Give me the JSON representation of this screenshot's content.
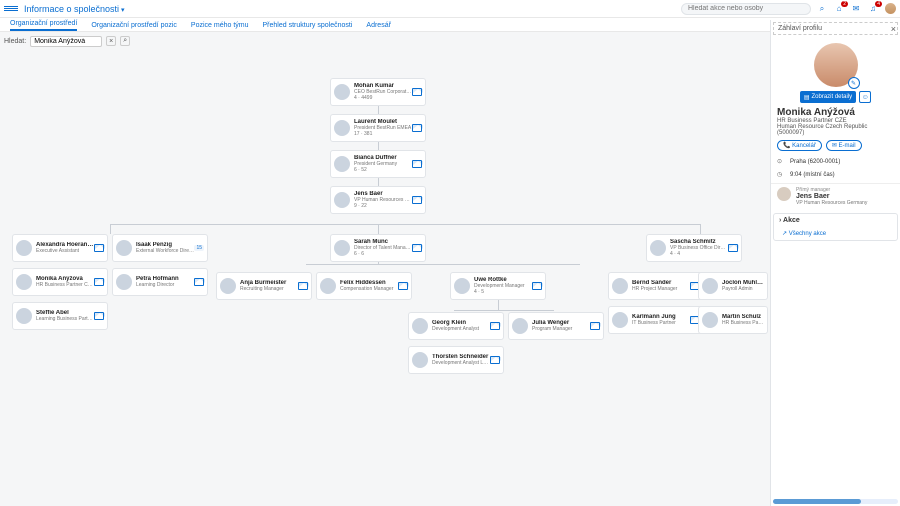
{
  "header": {
    "title": "Informace o společnosti",
    "search_placeholder": "Hledat akce nebo osoby",
    "notif1": "2",
    "notif2": "4"
  },
  "tabs": [
    "Organizační prostředí",
    "Organizační prostředí pozic",
    "Pozice mého týmu",
    "Přehled struktury společnosti",
    "Adresář"
  ],
  "find": {
    "label": "Hledat:",
    "value": "Monika Anýžová"
  },
  "org": {
    "c1": {
      "name": "Mohan Kumar",
      "role": "CEO BestRun Corporation",
      "sub": "4 · 4499"
    },
    "c2": {
      "name": "Laurent Moulet",
      "role": "President BestRun EMEA",
      "sub": "17 · 381"
    },
    "c3": {
      "name": "Bianca Duffner",
      "role": "President Germany",
      "sub": "6 · 52"
    },
    "c4": {
      "name": "Jens Baer",
      "role": "VP Human Resources Germ.",
      "sub": "9 · 22"
    },
    "l1": {
      "name": "Alexandra Hoerandel",
      "role": "Executive Assistant"
    },
    "l2": {
      "name": "Monika Anýžová",
      "role": "HR Business Partner CZE"
    },
    "l3": {
      "name": "Steffie Abel",
      "role": "Learning Business Partner"
    },
    "l4": {
      "name": "Isaak Penzig",
      "role": "External Workforce Director",
      "badge": "15"
    },
    "l5": {
      "name": "Petra Hofmann",
      "role": "Learning Director"
    },
    "m1": {
      "name": "Sarah Munc",
      "role": "Director of Talent Managem.",
      "sub": "6 · 6"
    },
    "m2": {
      "name": "Anja Burmeister",
      "role": "Recruiting Manager"
    },
    "m3": {
      "name": "Felix Hiddessen",
      "role": "Compensation Manager"
    },
    "m4": {
      "name": "Uwe Rottke",
      "role": "Development Manager",
      "sub": "4 · 5"
    },
    "m5": {
      "name": "Georg Klein",
      "role": "Development Analyst"
    },
    "m6": {
      "name": "Julia Wenger",
      "role": "Program Manager"
    },
    "m7": {
      "name": "Thorsten Schneider",
      "role": "Development Analyst Lead"
    },
    "r1": {
      "name": "Sascha Schmitz",
      "role": "VP Business Office Director",
      "sub": "4 · 4"
    },
    "r2": {
      "name": "Bernd Sander",
      "role": "HR Project Manager"
    },
    "r3": {
      "name": "Joclon Muhlfeld",
      "role": "Payroll Admin"
    },
    "r4": {
      "name": "Karlmann Jung",
      "role": "IT Business Partner"
    },
    "r5": {
      "name": "Martin Schulz",
      "role": "HR Business Partner"
    }
  },
  "panel": {
    "header_alt": "Záhlaví profilu",
    "show_details": "Zobrazit detaily",
    "name": "Monika Anýžová",
    "role": "HR Business Partner CZE",
    "dept": "Human Resource Czech Republic (5000097)",
    "office_btn": "Kancelář",
    "email_btn": "E-mail",
    "location": "Praha (6200-0001)",
    "time": "9:04 (místní čas)",
    "mgr_label": "Přímý manager",
    "mgr_name": "Jens Baer",
    "mgr_role": "VP Human Resources Germany",
    "acc": "Akce",
    "acc_link": "Všechny akce"
  }
}
